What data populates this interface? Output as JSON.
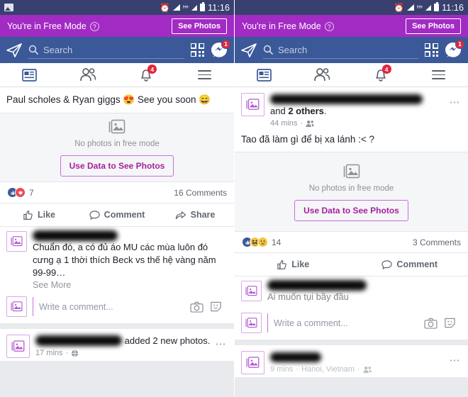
{
  "status_bar": {
    "photo_icon": "photo-icon",
    "alarm_icon": "alarm-clock-icon",
    "signal_icon": "signal-bars-icon",
    "network_label": "H+",
    "battery_icon": "battery-icon",
    "time": "11:16"
  },
  "free_mode_banner": {
    "text": "You're in Free Mode",
    "help_icon": "?",
    "see_photos_label": "See Photos"
  },
  "search_bar": {
    "send_icon": "paper-plane-icon",
    "search_icon": "search-icon",
    "placeholder": "Search",
    "qr_icon": "qr-code-icon",
    "messenger_icon": "messenger-icon",
    "messenger_badge": "1"
  },
  "tab_bar": {
    "tabs": [
      {
        "name": "news-feed",
        "icon": "news-feed-icon",
        "badge": ""
      },
      {
        "name": "friends",
        "icon": "friends-icon",
        "badge": ""
      },
      {
        "name": "notifications",
        "icon": "bell-icon",
        "badge": "4"
      },
      {
        "name": "menu",
        "icon": "hamburger-icon",
        "badge": ""
      }
    ]
  },
  "photo_placeholder": {
    "icon": "photo-stack-icon",
    "caption": "No photos in free mode",
    "button_label": "Use Data to See Photos"
  },
  "actions": {
    "like": "Like",
    "comment": "Comment",
    "share": "Share"
  },
  "composer": {
    "placeholder": "Write a comment...",
    "camera_icon": "camera-icon",
    "sticker_icon": "sticker-icon"
  },
  "colors": {
    "status_bar": "#37406e",
    "free_mode_purple": "#a22bc4",
    "facebook_blue": "#3b5998",
    "badge_red": "#e4253b",
    "accent_purple": "#a4219f",
    "feed_gray": "#e9eaed"
  },
  "left_screen": {
    "post_top": {
      "status_text": "Paul scholes & Ryan giggs 😍 See you soon 😄",
      "reaction_count": "7",
      "reaction_types": [
        "like",
        "love"
      ],
      "comments_label": "16 Comments"
    },
    "comment": {
      "author": "REDACTED",
      "text": "Chuẩn đó, a có đủ áo MU các mùa luôn đó cưng ạ 1 thời thích Beck vs thế hệ vàng năm 99-99…",
      "see_more": "See More"
    },
    "post_bottom": {
      "name": "REDACTED",
      "action_text": "added 2 new photos.",
      "timestamp": "17 mins",
      "privacy_icon": "globe-icon"
    }
  },
  "right_screen": {
    "post_top": {
      "name": "REDACTED",
      "and_text": "and",
      "others_count": "2 others",
      "others_suffix": ".",
      "timestamp": "44 mins",
      "privacy_icon": "friends-icon",
      "status_text": "Tao đã làm gì để bị xa lánh :< ?",
      "reaction_count": "14",
      "reaction_types": [
        "like",
        "haha",
        "sad"
      ],
      "comments_label": "3 Comments"
    },
    "comment": {
      "author": "REDACTED",
      "text": "Ai muốn tụi bầy đầu"
    },
    "post_bottom": {
      "name": "REDACTED",
      "timestamp": "9 mins",
      "location": "Hanoi, Vietnam",
      "privacy_icon": "friends-icon"
    }
  }
}
